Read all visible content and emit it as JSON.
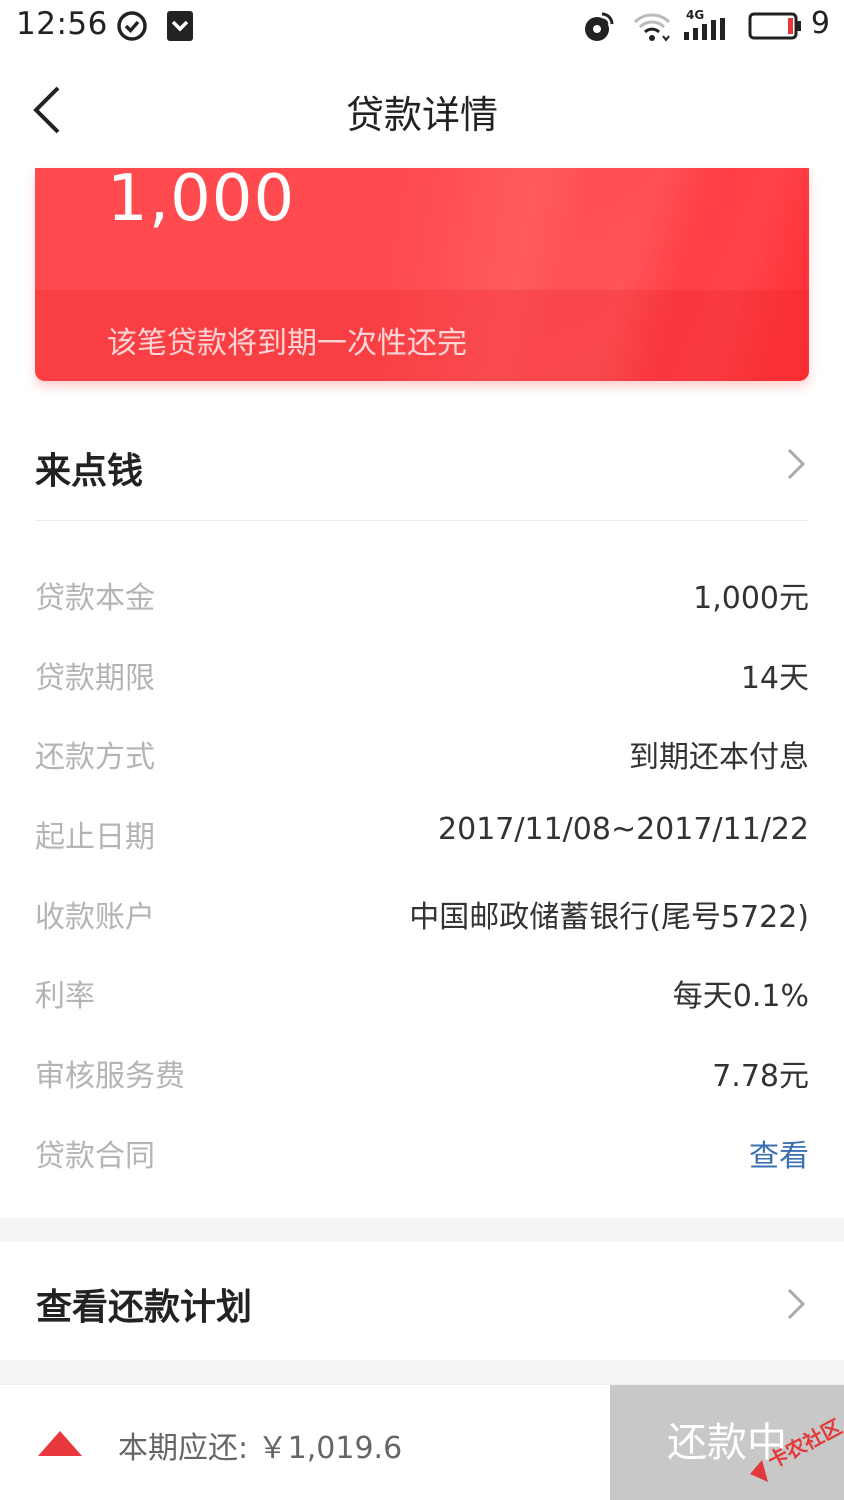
{
  "status_bar": {
    "time": "12:56",
    "network": "4G",
    "battery": "9"
  },
  "nav": {
    "title": "贷款详情"
  },
  "loan_card": {
    "amount": "1,000",
    "note": "该笔贷款将到期一次性还完"
  },
  "product": {
    "name": "来点钱"
  },
  "details": [
    {
      "label": "贷款本金",
      "value": "1,000元"
    },
    {
      "label": "贷款期限",
      "value": "14天"
    },
    {
      "label": "还款方式",
      "value": "到期还本付息"
    },
    {
      "label": "起止日期",
      "value": "2017/11/08~2017/11/22"
    },
    {
      "label": "收款账户",
      "value": "中国邮政储蓄银行(尾号5722)"
    },
    {
      "label": "利率",
      "value": "每天0.1%"
    },
    {
      "label": "审核服务费",
      "value": "7.78元"
    },
    {
      "label": "贷款合同",
      "value": "查看"
    }
  ],
  "plan": {
    "label": "查看还款计划"
  },
  "bottom": {
    "due_label": "本期应还: ￥1,019.6",
    "repay_button": "还款中"
  },
  "watermark": {
    "text": "卡农社区"
  },
  "colors": {
    "card_red": "#ff4a4f",
    "link_blue": "#3a6fb0",
    "accent_red": "#e8383d",
    "button_gray": "#c8c8c8"
  }
}
